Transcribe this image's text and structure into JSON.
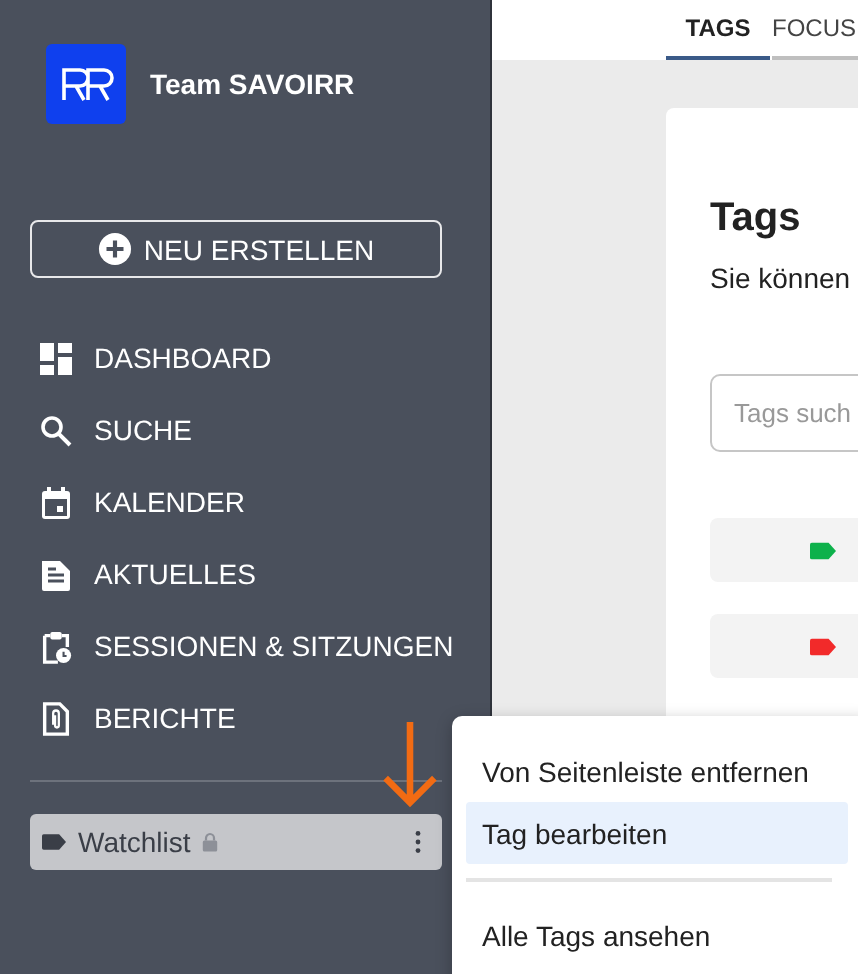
{
  "team": {
    "name": "Team SAVOIRR"
  },
  "create_button": {
    "label": "NEU ERSTELLEN"
  },
  "nav": [
    {
      "label": "DASHBOARD",
      "kind": "dashboard"
    },
    {
      "label": "SUCHE",
      "kind": "search"
    },
    {
      "label": "KALENDER",
      "kind": "calendar"
    },
    {
      "label": "AKTUELLES",
      "kind": "document"
    },
    {
      "label": "SESSIONEN & SITZUNGEN",
      "kind": "clipboard"
    },
    {
      "label": "BERICHTE",
      "kind": "attachment"
    }
  ],
  "sidebar_tags": [
    {
      "label": "Watchlist",
      "locked": true,
      "selected": true
    }
  ],
  "tabs": [
    {
      "label": "TAGS",
      "selected": true
    },
    {
      "label": "FOCUS",
      "selected": false
    }
  ],
  "page": {
    "title": "Tags",
    "description": "Sie können",
    "search": {
      "placeholder": "Tags such"
    },
    "tag_rows": [
      {
        "color": "#0db14b"
      },
      {
        "color": "#f22a2a"
      }
    ]
  },
  "context_menu": {
    "sections": [
      [
        {
          "label": "Von Seitenleiste entfernen",
          "selected": false
        },
        {
          "label": "Tag bearbeiten",
          "selected": true
        }
      ],
      [
        {
          "label": "Alle Tags ansehen",
          "selected": false
        }
      ]
    ]
  }
}
